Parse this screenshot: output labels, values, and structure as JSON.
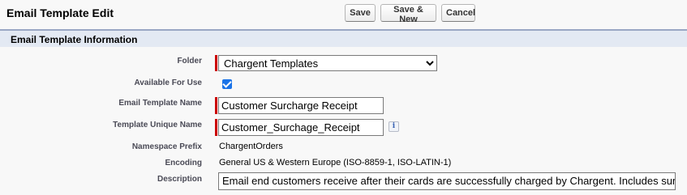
{
  "header": {
    "title": "Email Template Edit",
    "buttons": {
      "save": "Save",
      "save_new": "Save & New",
      "cancel": "Cancel"
    }
  },
  "section": {
    "title": "Email Template Information"
  },
  "form": {
    "folder": {
      "label": "Folder",
      "value": "Chargent Templates"
    },
    "available": {
      "label": "Available For Use",
      "checked": true
    },
    "template_name": {
      "label": "Email Template Name",
      "value": "Customer Surcharge Receipt"
    },
    "unique_name": {
      "label": "Template Unique Name",
      "value": "Customer_Surchage_Receipt"
    },
    "namespace": {
      "label": "Namespace Prefix",
      "value": "ChargentOrders"
    },
    "encoding": {
      "label": "Encoding",
      "value": "General US & Western Europe (ISO-8859-1, ISO-LATIN-1)"
    },
    "description": {
      "label": "Description",
      "value": "Email end customers receive after their cards are successfully charged by Chargent. Includes surcharge details."
    }
  },
  "icons": {
    "info": "i"
  },
  "colors": {
    "required": "#cc0000",
    "section_bg": "#e3e9f3",
    "checkbox": "#1a73e8"
  }
}
